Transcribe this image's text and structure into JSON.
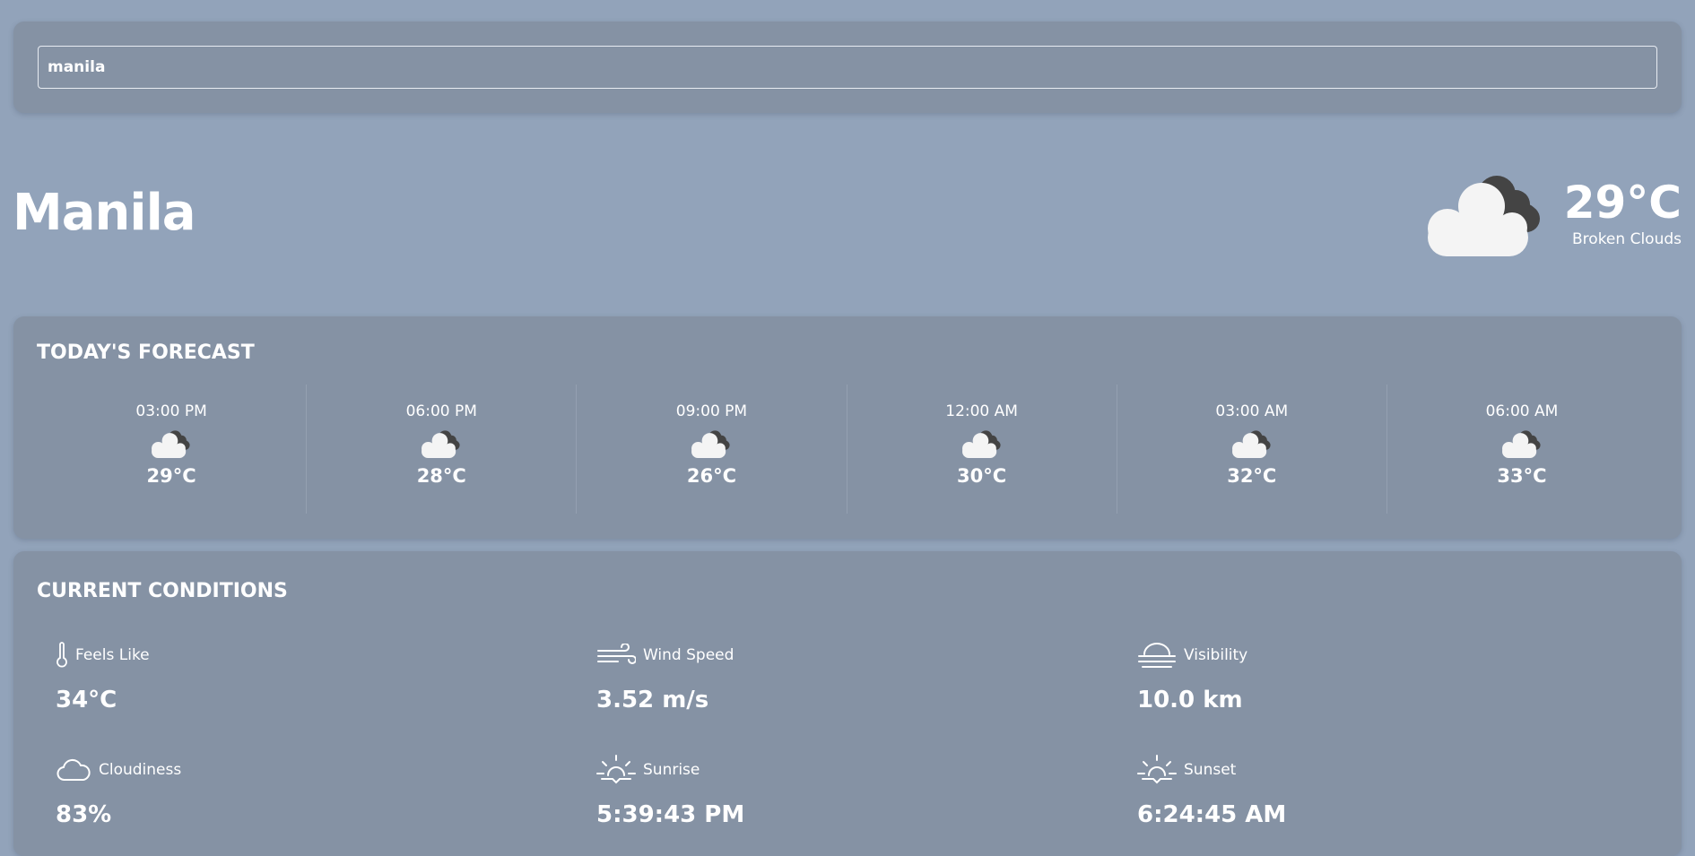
{
  "search": {
    "value": "manila"
  },
  "location": {
    "city": "Manila"
  },
  "current": {
    "temperature": "29°C",
    "description": "Broken Clouds",
    "icon": "broken-clouds-icon"
  },
  "forecast": {
    "title": "TODAY'S FORECAST",
    "items": [
      {
        "time": "03:00 PM",
        "temp": "29°C",
        "icon": "broken-clouds-icon"
      },
      {
        "time": "06:00 PM",
        "temp": "28°C",
        "icon": "broken-clouds-icon"
      },
      {
        "time": "09:00 PM",
        "temp": "26°C",
        "icon": "broken-clouds-icon"
      },
      {
        "time": "12:00 AM",
        "temp": "30°C",
        "icon": "broken-clouds-icon"
      },
      {
        "time": "03:00 AM",
        "temp": "32°C",
        "icon": "broken-clouds-icon"
      },
      {
        "time": "06:00 AM",
        "temp": "33°C",
        "icon": "broken-clouds-icon"
      }
    ]
  },
  "conditions": {
    "title": "CURRENT CONDITIONS",
    "feels_like": {
      "label": "Feels Like",
      "value": "34°C",
      "icon": "thermometer-icon"
    },
    "wind_speed": {
      "label": "Wind Speed",
      "value": "3.52 m/s",
      "icon": "wind-icon"
    },
    "visibility": {
      "label": "Visibility",
      "value": "10.0 km",
      "icon": "fog-icon"
    },
    "cloudiness": {
      "label": "Cloudiness",
      "value": "83%",
      "icon": "cloud-icon"
    },
    "sunrise": {
      "label": "Sunrise",
      "value": "5:39:43 PM",
      "icon": "sunrise-icon"
    },
    "sunset": {
      "label": "Sunset",
      "value": "6:24:45 AM",
      "icon": "sunset-icon"
    }
  },
  "colors": {
    "background": "#92a3ba",
    "card": "#8592a4",
    "text": "#ffffff",
    "cloud_light": "#f4f4f4",
    "cloud_dark": "#444444"
  }
}
